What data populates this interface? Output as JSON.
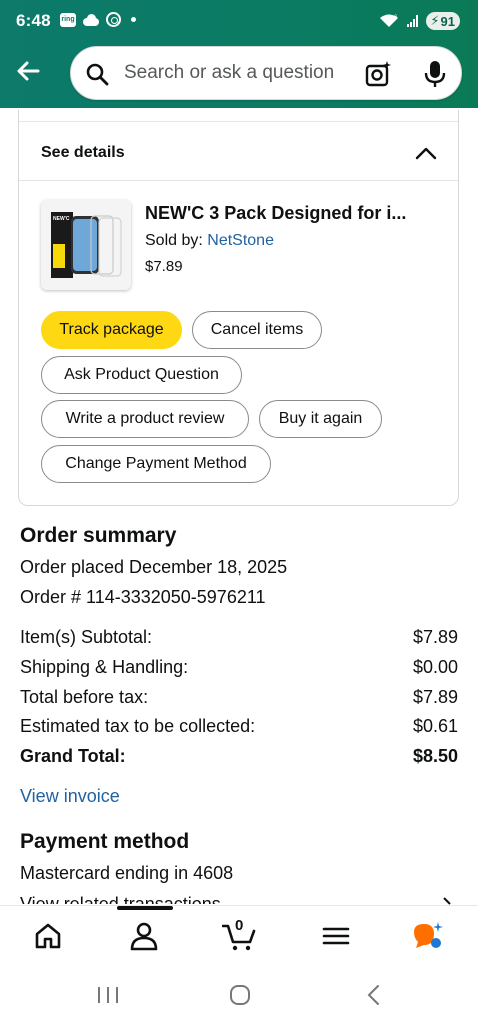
{
  "status_bar": {
    "time": "6:48",
    "ring_label": "ring",
    "battery": "91"
  },
  "search": {
    "placeholder": "Search or ask a question"
  },
  "item_card": {
    "see_details": "See details",
    "product_title": "NEW'C 3 Pack Designed for i...",
    "sold_by_label": "Sold by: ",
    "seller": "NetStone",
    "price": "$7.89",
    "thumb_label": "NEW'C",
    "actions": {
      "track_package": "Track package",
      "cancel_items": "Cancel items",
      "ask_question": "Ask Product Question",
      "write_review": "Write a product review",
      "buy_again": "Buy it again",
      "change_payment": "Change Payment Method"
    }
  },
  "order_summary": {
    "heading": "Order summary",
    "placed": "Order placed December 18, 2025",
    "order_number": "Order # 114-3332050-5976211",
    "lines": [
      {
        "label": "Item(s) Subtotal:",
        "value": "$7.89"
      },
      {
        "label": "Shipping & Handling:",
        "value": "$0.00"
      },
      {
        "label": "Total before tax:",
        "value": "$7.89"
      },
      {
        "label": "Estimated tax to be collected:",
        "value": "$0.61"
      },
      {
        "label": "Grand Total:",
        "value": "$8.50"
      }
    ],
    "view_invoice": "View invoice"
  },
  "payment": {
    "heading": "Payment method",
    "card": "Mastercard  ending in 4608",
    "related": "View related transactions"
  },
  "bottom_nav": {
    "cart_count": "0"
  },
  "colors": {
    "header_green": "#0d7a6a",
    "button_yellow": "#ffd814",
    "link_blue": "#2162a1"
  },
  "icons": [
    "back-arrow-icon",
    "search-icon",
    "camera-icon",
    "mic-icon",
    "chevron-up-icon",
    "home-icon",
    "profile-icon",
    "cart-icon",
    "menu-icon",
    "rufus-icon",
    "chevron-right-icon"
  ]
}
